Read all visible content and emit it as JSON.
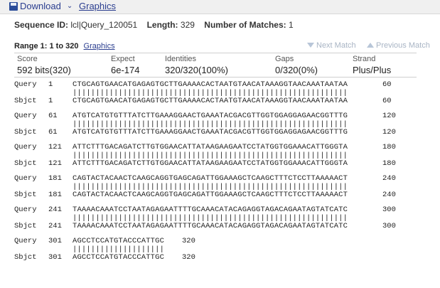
{
  "toolbar": {
    "download_label": "Download",
    "download_icon": "disk-icon",
    "chevron_icon": "chevron-down-icon",
    "graphics_label": "Graphics"
  },
  "sequence_info": {
    "sequence_id_label": "Sequence ID:",
    "sequence_id": "lcl|Query_120051",
    "length_label": "Length:",
    "length": "329",
    "matches_label": "Number of Matches:",
    "matches": "1"
  },
  "range": {
    "label": "Range 1: 1 to 320",
    "graphics_link": "Graphics",
    "next_match": "Next Match",
    "previous_match": "Previous Match"
  },
  "stats": {
    "score_header": "Score",
    "score_value": "592 bits(320)",
    "expect_header": "Expect",
    "expect_value": "6e-174",
    "identities_header": "Identities",
    "identities_value": "320/320(100%)",
    "gaps_header": "Gaps",
    "gaps_value": "0/320(0%)",
    "strand_header": "Strand",
    "strand_value": "Plus/Plus"
  },
  "alignment": [
    {
      "q_label": "Query",
      "q_start": "1",
      "q_seq": "CTGCAGTGAACATGAGAGTGCTTGAAAACACTAATGTAACATAAAGGTAACAAATAATAA",
      "q_end": "60",
      "match": "||||||||||||||||||||||||||||||||||||||||||||||||||||||||||||",
      "s_label": "Sbjct",
      "s_start": "1",
      "s_seq": "CTGCAGTGAACATGAGAGTGCTTGAAAACACTAATGTAACATAAAGGTAACAAATAATAA",
      "s_end": "60"
    },
    {
      "q_label": "Query",
      "q_start": "61",
      "q_seq": "ATGTCATGTGTTTATCTTGAAAGGAACTGAAATACGACGTTGGTGGAGGAGAACGGTTTG",
      "q_end": "120",
      "match": "||||||||||||||||||||||||||||||||||||||||||||||||||||||||||||",
      "s_label": "Sbjct",
      "s_start": "61",
      "s_seq": "ATGTCATGTGTTTATCTTGAAAGGAACTGAAATACGACGTTGGTGGAGGAGAACGGTTTG",
      "s_end": "120"
    },
    {
      "q_label": "Query",
      "q_start": "121",
      "q_seq": "ATTCTTTGACAGATCTTGTGGAACATTATAAGAAGAATCCTATGGTGGAAACATTGGGTA",
      "q_end": "180",
      "match": "||||||||||||||||||||||||||||||||||||||||||||||||||||||||||||",
      "s_label": "Sbjct",
      "s_start": "121",
      "s_seq": "ATTCTTTGACAGATCTTGTGGAACATTATAAGAAGAATCCTATGGTGGAAACATTGGGTA",
      "s_end": "180"
    },
    {
      "q_label": "Query",
      "q_start": "181",
      "q_seq": "CAGTACTACAACTCAAGCAGGTGAGCAGATTGGAAAGCTCAAGCTTTCTCCTTAAAAACT",
      "q_end": "240",
      "match": "||||||||||||||||||||||||||||||||||||||||||||||||||||||||||||",
      "s_label": "Sbjct",
      "s_start": "181",
      "s_seq": "CAGTACTACAACTCAAGCAGGTGAGCAGATTGGAAAGCTCAAGCTTTCTCCTTAAAAACT",
      "s_end": "240"
    },
    {
      "q_label": "Query",
      "q_start": "241",
      "q_seq": "TAAAACAAATCCTAATAGAGAATTTTGCAAACATACAGAGGTAGACAGAATAGTATCATC",
      "q_end": "300",
      "match": "||||||||||||||||||||||||||||||||||||||||||||||||||||||||||||",
      "s_label": "Sbjct",
      "s_start": "241",
      "s_seq": "TAAAACAAATCCTAATAGAGAATTTTGCAAACATACAGAGGTAGACAGAATAGTATCATC",
      "s_end": "300"
    },
    {
      "q_label": "Query",
      "q_start": "301",
      "q_seq": "AGCCTCCATGTACCCATTGC",
      "q_end": "320",
      "match": "||||||||||||||||||||",
      "s_label": "Sbjct",
      "s_start": "301",
      "s_seq": "AGCCTCCATGTACCCATTGC",
      "s_end": "320"
    }
  ]
}
